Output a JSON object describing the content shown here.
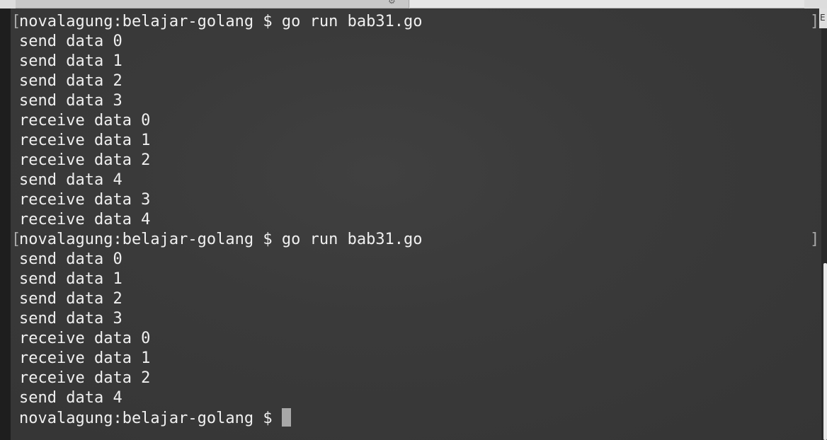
{
  "terminal": {
    "lines": [
      "novalagung:belajar-golang $ go run bab31.go",
      "send data 0",
      "send data 1",
      "send data 2",
      "send data 3",
      "receive data 0",
      "receive data 1",
      "receive data 2",
      "send data 4",
      "receive data 3",
      "receive data 4",
      "novalagung:belajar-golang $ go run bab31.go",
      "send data 0",
      "send data 1",
      "send data 2",
      "send data 3",
      "receive data 0",
      "receive data 1",
      "receive data 2",
      "send data 4"
    ],
    "prompt": "novalagung:belajar-golang $ "
  },
  "chrome": {
    "left_bracket": "[",
    "right_bracket": "]",
    "tab_gear_glyph": "⚙",
    "left_glyph": "›",
    "top_right_glyph": "E",
    "tab_gear_icon": "gear-icon",
    "cursor_color": "#a8a8a8",
    "background_color": "#3a3a3a",
    "text_color": "#f0f0f0"
  }
}
